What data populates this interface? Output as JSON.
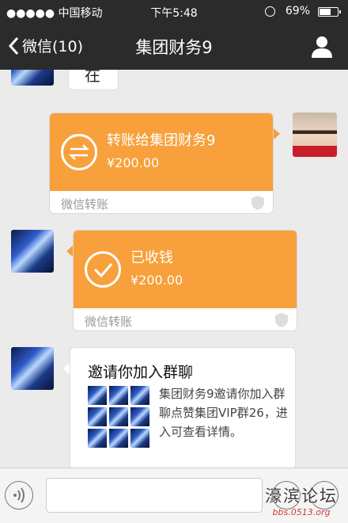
{
  "status_bar": {
    "carrier": "●●●●● 中国移动",
    "time": "下午5:48",
    "battery": "69%",
    "battery_level": 0.69
  },
  "nav": {
    "back_label": "微信(10)",
    "title": "集团财务9"
  },
  "messages": {
    "partial_text": "在",
    "transfer": {
      "title": "转账给集团财务9",
      "amount": "¥200.00",
      "footer": "微信转账"
    },
    "received": {
      "title": "已收钱",
      "amount": "¥200.00",
      "footer": "微信转账"
    },
    "invite": {
      "title": "邀请你加入群聊",
      "description": "集团财务9邀请你加入群聊点赞集团VIP群26，进入可查看详情。"
    }
  },
  "input_bar": {
    "placeholder": ""
  },
  "watermark": {
    "top": "濠滨论坛",
    "bottom": "bbs.0513.org"
  },
  "colors": {
    "nav_bg": "#2b2b2b",
    "chat_bg": "#ebebeb",
    "transfer_orange": "#f7a03c"
  }
}
